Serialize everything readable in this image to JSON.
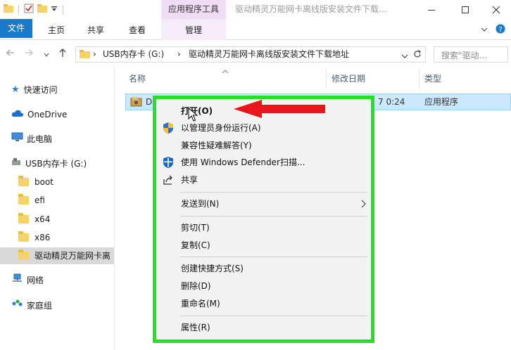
{
  "window": {
    "context_tab_header": "应用程序工具",
    "title": "驱动精灵万能网卡离线版安装文件下载..."
  },
  "ribbon": {
    "tabs": [
      "文件",
      "主页",
      "共享",
      "查看",
      "管理"
    ]
  },
  "address": {
    "crumbs": [
      "USB内存卡 (G:)",
      "驱动精灵万能网卡离线版安装文件下载地址"
    ],
    "search_placeholder": "搜索\"驱动..."
  },
  "nav": {
    "items": [
      {
        "label": "快速访问",
        "icon": "star-icon"
      },
      {
        "label": "OneDrive",
        "icon": "cloud-icon"
      },
      {
        "label": "此电脑",
        "icon": "computer-icon"
      },
      {
        "label": "USB内存卡 (G:)",
        "icon": "usb-drive-icon"
      },
      {
        "label": "boot",
        "icon": "folder-icon"
      },
      {
        "label": "efi",
        "icon": "folder-icon"
      },
      {
        "label": "x64",
        "icon": "folder-icon"
      },
      {
        "label": "x86",
        "icon": "folder-icon"
      },
      {
        "label": "驱动精灵万能网卡离",
        "icon": "folder-icon"
      },
      {
        "label": "网络",
        "icon": "network-icon"
      },
      {
        "label": "家庭组",
        "icon": "homegroup-icon"
      }
    ]
  },
  "columns": {
    "name": "名称",
    "modified": "修改日期",
    "type": "类型"
  },
  "file": {
    "name": "D",
    "modified": "7 0:24",
    "type": "应用程序"
  },
  "context_menu": {
    "open": "打开(O)",
    "run_as_admin": "以管理员身份运行(A)",
    "troubleshoot": "兼容性疑难解答(Y)",
    "defender": "使用 Windows Defender扫描...",
    "share": "共享",
    "send_to": "发送到(N)",
    "cut": "剪切(T)",
    "copy": "复制(C)",
    "create_shortcut": "创建快捷方式(S)",
    "delete": "删除(D)",
    "rename": "重命名(M)",
    "properties": "属性(R)"
  },
  "colors": {
    "file_tab": "#1979ca",
    "context_tab": "#f0dcf5",
    "selection": "#cce8ff",
    "highlight_box": "#23e223",
    "arrow": "#e8161b"
  }
}
